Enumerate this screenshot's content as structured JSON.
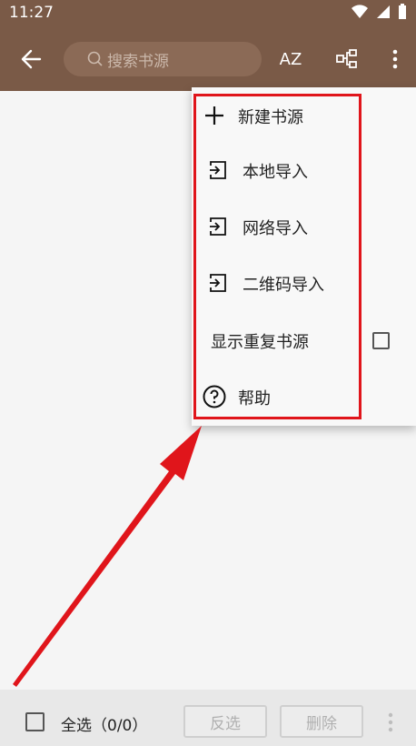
{
  "status": {
    "time": "11:27"
  },
  "appbar": {
    "search_placeholder": "搜索书源",
    "sort_icon_text": "AZ"
  },
  "menu": {
    "items": [
      {
        "label": "新建书源",
        "icon": "plus-icon"
      },
      {
        "label": "本地导入",
        "icon": "import-icon"
      },
      {
        "label": "网络导入",
        "icon": "import-icon"
      },
      {
        "label": "二维码导入",
        "icon": "import-icon"
      },
      {
        "label": "显示重复书源",
        "icon": "checkbox"
      },
      {
        "label": "帮助",
        "icon": "help-icon"
      }
    ]
  },
  "bottom": {
    "select_all_label": "全选（0/0）",
    "invert_label": "反选",
    "delete_label": "删除"
  },
  "colors": {
    "appbar": "#7a5a47",
    "highlight": "#e0151b",
    "arrow": "#e0151b"
  }
}
